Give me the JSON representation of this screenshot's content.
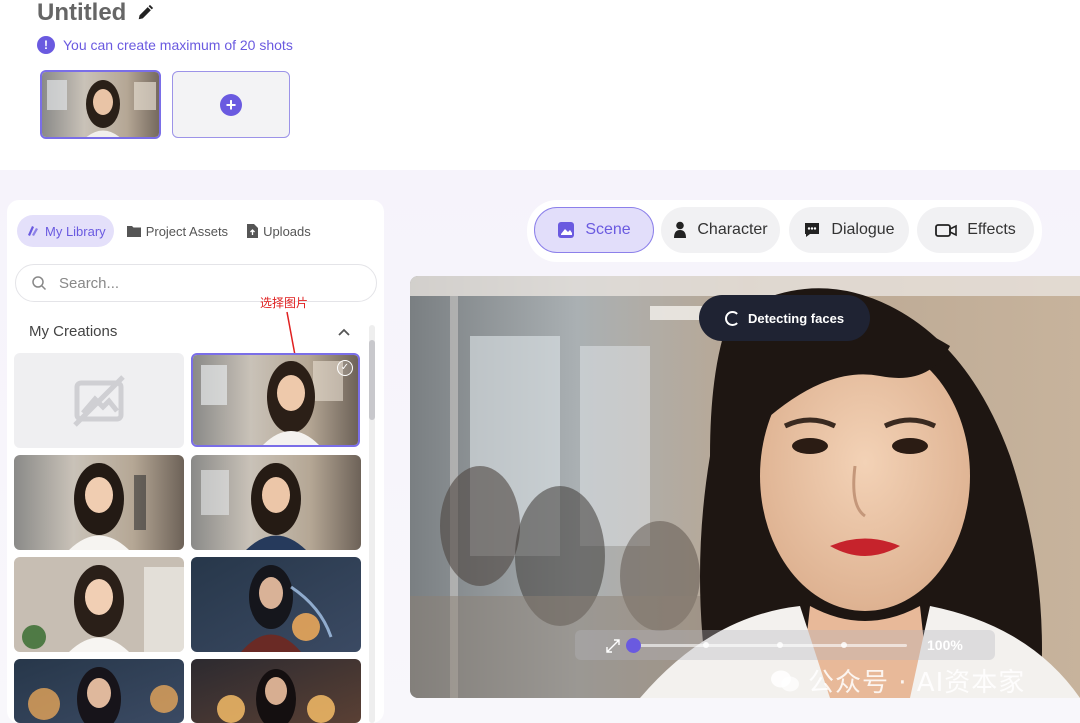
{
  "header": {
    "title": "Untitled",
    "notice": "You can create maximum of 20 shots",
    "notice_icon": "!"
  },
  "shots": {
    "add_icon": "+"
  },
  "library": {
    "tabs": [
      {
        "label": "My Library",
        "icon": "library-icon",
        "active": true
      },
      {
        "label": "Project Assets",
        "icon": "folder-icon",
        "active": false
      },
      {
        "label": "Uploads",
        "icon": "file-upload-icon",
        "active": false
      }
    ],
    "search_placeholder": "Search...",
    "section_title": "My Creations",
    "annotation": "选择图片",
    "check_mark": "✓"
  },
  "modes": [
    {
      "label": "Scene",
      "icon": "image-icon",
      "active": true
    },
    {
      "label": "Character",
      "icon": "person-icon",
      "active": false
    },
    {
      "label": "Dialogue",
      "icon": "chat-icon",
      "active": false
    },
    {
      "label": "Effects",
      "icon": "camera-icon",
      "active": false
    }
  ],
  "preview": {
    "status": "Detecting faces",
    "zoom_value": "100%",
    "zoom_level": 1.0,
    "watermark": "公众号 · AI资本家"
  },
  "colors": {
    "accent": "#6a5ae0",
    "accent_light": "#e2defa",
    "status_bg": "#1f2333"
  }
}
